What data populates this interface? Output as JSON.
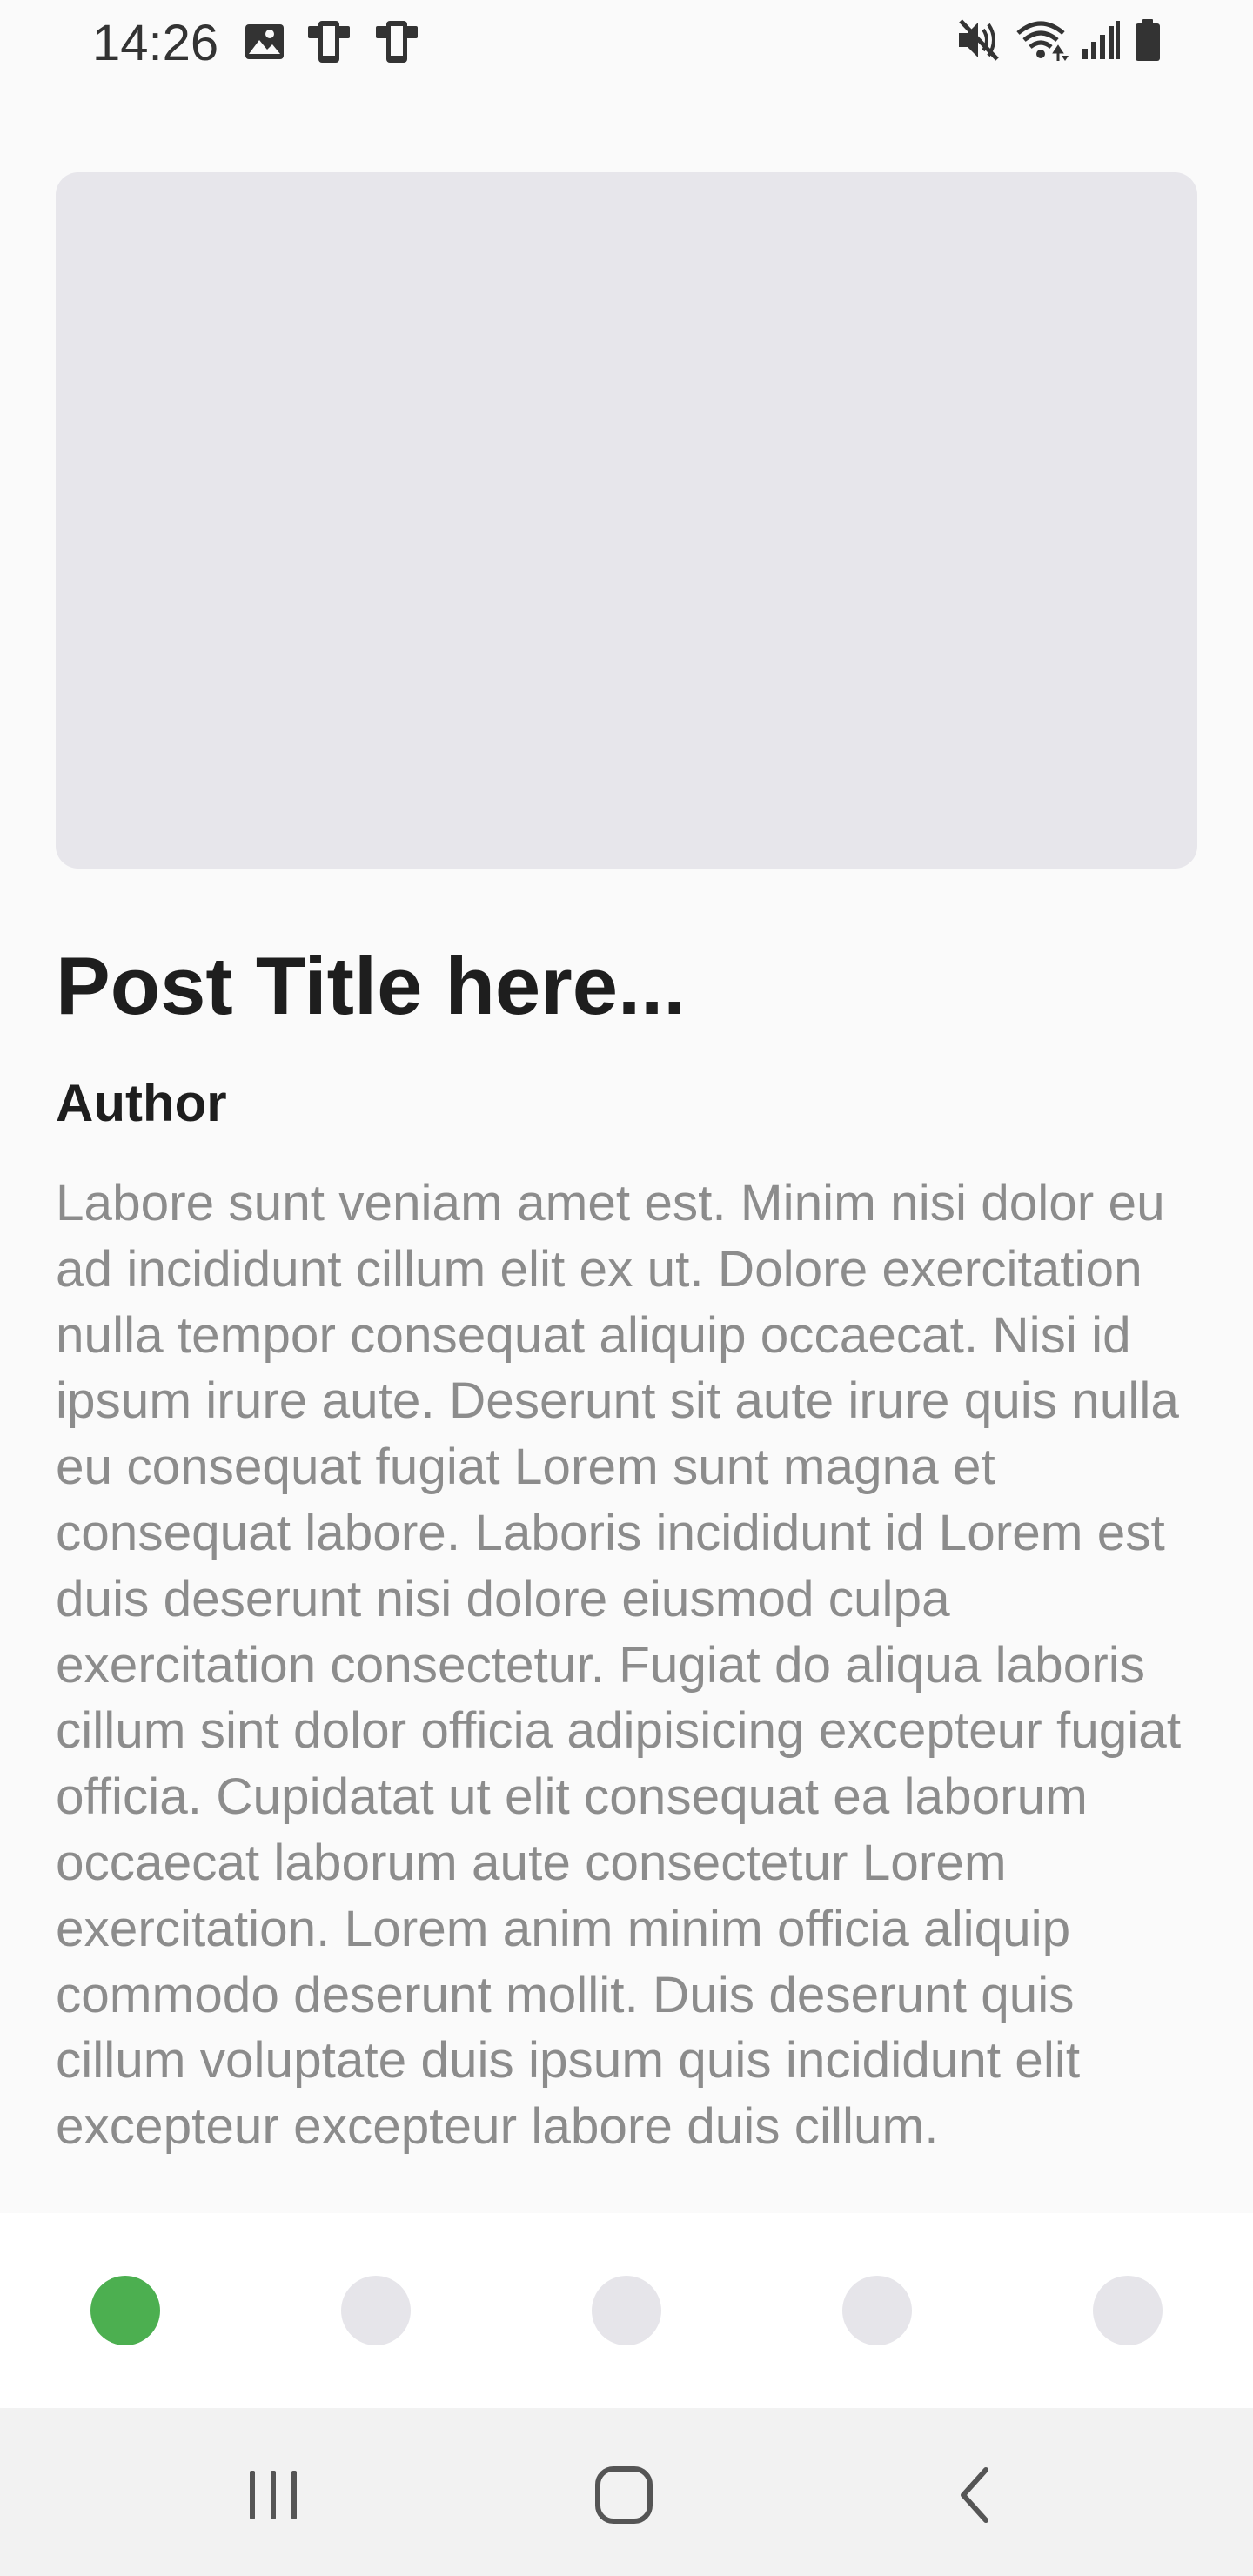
{
  "status_bar": {
    "time": "14:26",
    "left_icons": [
      "image-icon",
      "device-icon",
      "device-icon"
    ],
    "right_icons": [
      "mute-icon",
      "wifi-icon",
      "signal-icon",
      "battery-icon"
    ]
  },
  "post": {
    "title": "Post Title here...",
    "author": "Author",
    "body": "Labore sunt veniam amet est. Minim nisi dolor eu ad incididunt cillum elit ex ut. Dolore exercitation nulla tempor consequat aliquip occaecat. Nisi id ipsum irure aute. Deserunt sit aute irure quis nulla eu consequat fugiat Lorem sunt magna et consequat labore. Laboris incididunt id Lorem est duis deserunt nisi dolore eiusmod culpa exercitation consectetur. Fugiat do aliqua laboris cillum sint dolor officia adipisicing excepteur fugiat officia. Cupidatat ut elit consequat ea laborum occaecat laborum aute consectetur Lorem exercitation. Lorem anim minim officia aliquip commodo deserunt mollit. Duis deserunt quis cillum voluptate duis ipsum quis incididunt elit excepteur excepteur labore duis cillum."
  },
  "pager": {
    "total": 5,
    "active_index": 0,
    "active_color": "#4caf50",
    "inactive_color": "#e6e5ea"
  },
  "nav_bar": {
    "buttons": [
      "recent-apps-icon",
      "home-icon",
      "back-icon"
    ]
  }
}
